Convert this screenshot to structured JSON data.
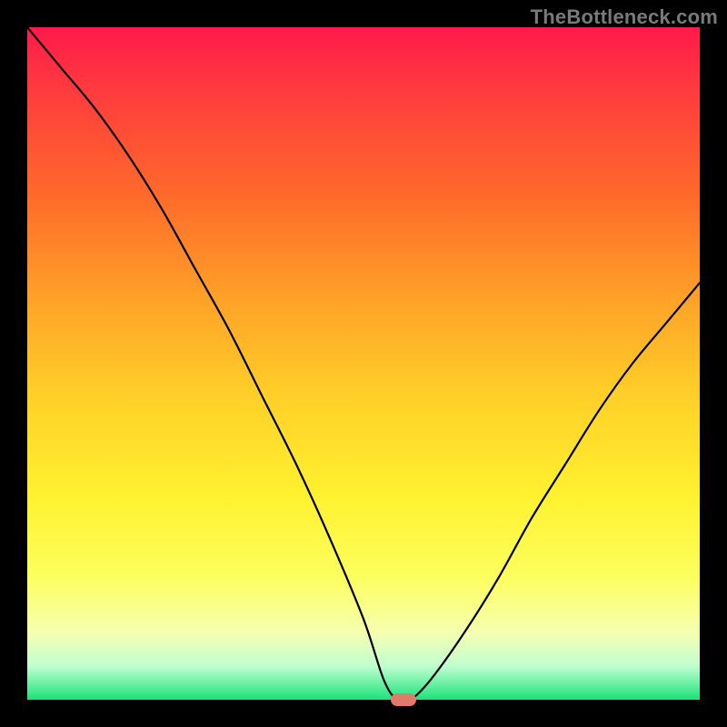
{
  "watermark": "TheBottleneck.com",
  "colors": {
    "frame": "#000000",
    "curve": "#000000",
    "marker": "#e07a6a"
  },
  "chart_data": {
    "type": "line",
    "title": "",
    "xlabel": "",
    "ylabel": "",
    "xlim": [
      0,
      100
    ],
    "ylim": [
      0,
      100
    ],
    "grid": false,
    "series": [
      {
        "name": "bottleneck-curve",
        "x": [
          0,
          5,
          10,
          15,
          20,
          25,
          30,
          35,
          40,
          45,
          50,
          53,
          55,
          57,
          60,
          65,
          70,
          75,
          80,
          85,
          90,
          95,
          100
        ],
        "values": [
          100,
          94,
          88,
          81,
          73,
          64,
          55,
          45,
          35,
          24,
          12,
          3,
          0,
          0,
          3,
          10,
          18,
          27,
          35,
          43,
          50,
          56,
          62
        ]
      }
    ],
    "marker": {
      "x": 56,
      "y": 0
    }
  }
}
